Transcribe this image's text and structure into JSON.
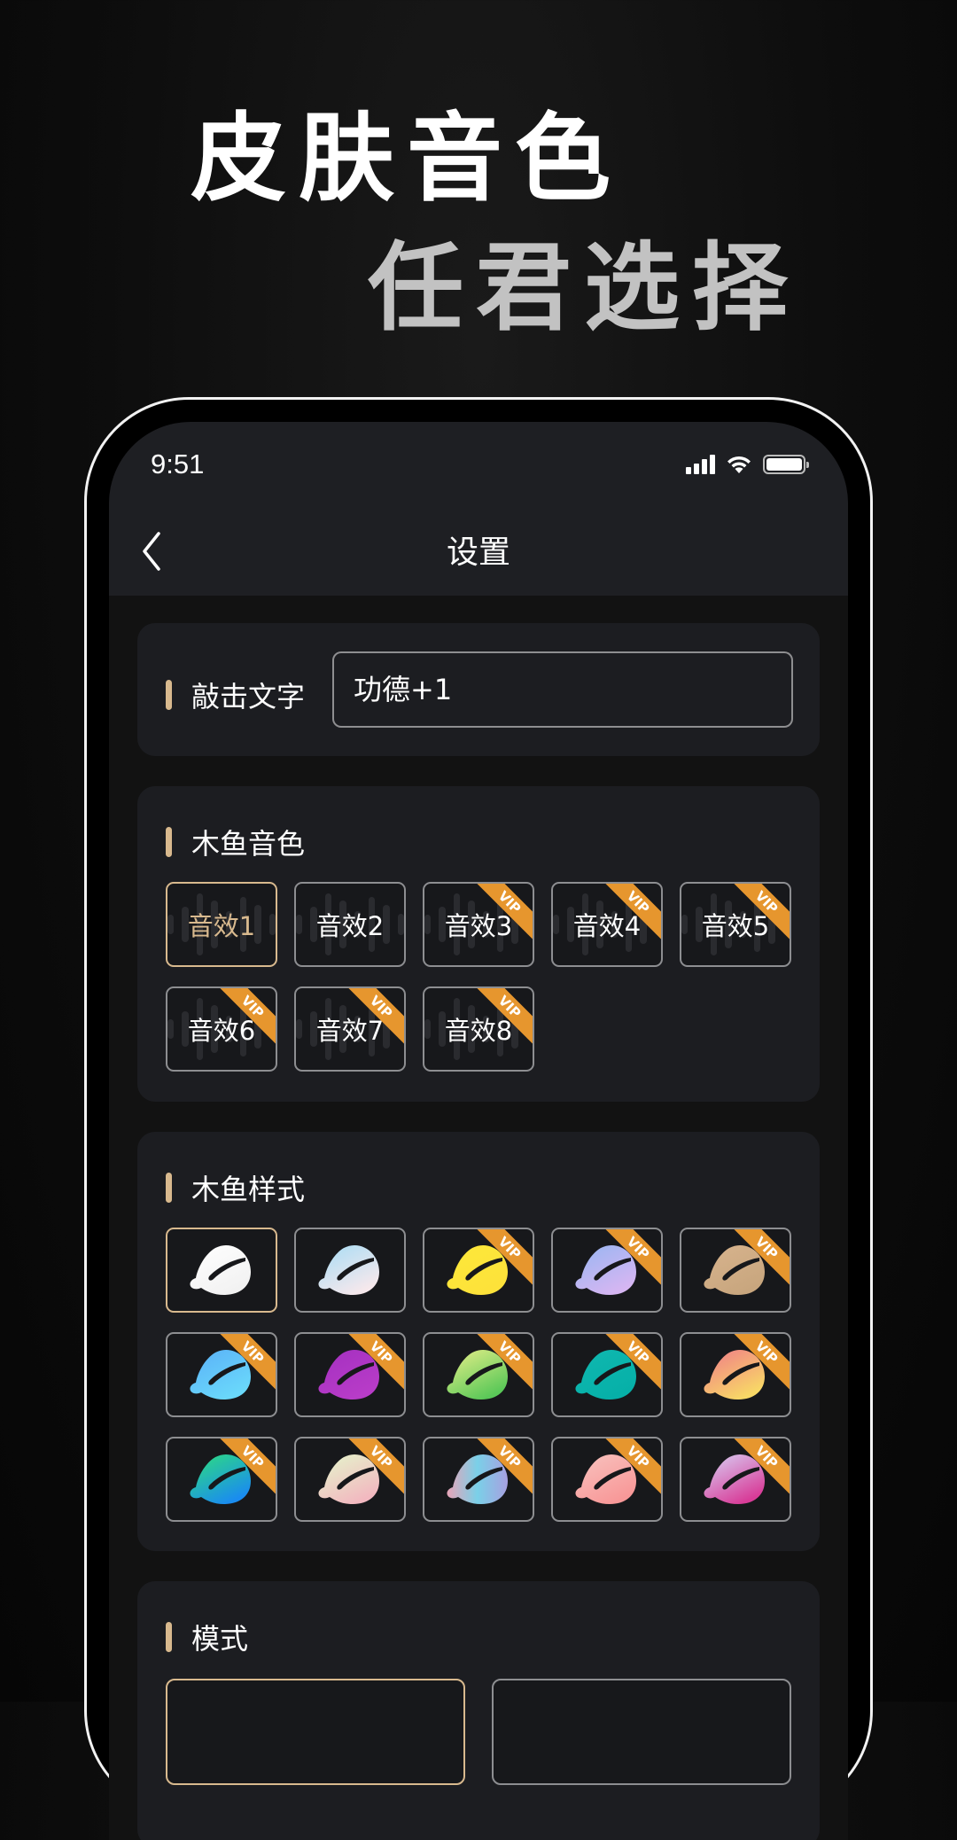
{
  "promo": {
    "line1": "皮肤音色",
    "line2": "任君选择"
  },
  "status_bar": {
    "time": "9:51",
    "icons": [
      "signal-icon",
      "wifi-icon",
      "battery-icon"
    ]
  },
  "nav": {
    "back_icon": "chevron-left-icon",
    "title": "设置"
  },
  "tap_text": {
    "label": "敲击文字",
    "value": "功德+1"
  },
  "sound": {
    "title": "木鱼音色",
    "options": [
      {
        "label": "音效1",
        "vip": false,
        "selected": true
      },
      {
        "label": "音效2",
        "vip": false,
        "selected": false
      },
      {
        "label": "音效3",
        "vip": true,
        "selected": false
      },
      {
        "label": "音效4",
        "vip": true,
        "selected": false
      },
      {
        "label": "音效5",
        "vip": true,
        "selected": false
      },
      {
        "label": "音效6",
        "vip": true,
        "selected": false
      },
      {
        "label": "音效7",
        "vip": true,
        "selected": false
      },
      {
        "label": "音效8",
        "vip": true,
        "selected": false
      }
    ]
  },
  "vip_badge": "VIP",
  "style": {
    "title": "木鱼样式",
    "options": [
      {
        "name": "white",
        "colors": [
          "#ffffff",
          "#f2f2f2"
        ],
        "vip": false,
        "selected": true
      },
      {
        "name": "sky",
        "colors": [
          "#a6dcf5",
          "#f6e8ec"
        ],
        "vip": false,
        "selected": false
      },
      {
        "name": "yellow",
        "colors": [
          "#fde83a",
          "#fde23a"
        ],
        "vip": true,
        "selected": false
      },
      {
        "name": "lavender",
        "colors": [
          "#96b6f2",
          "#d6b6f2"
        ],
        "vip": true,
        "selected": false
      },
      {
        "name": "tan",
        "colors": [
          "#d8b48e",
          "#c8a67e"
        ],
        "vip": true,
        "selected": false
      },
      {
        "name": "blue",
        "colors": [
          "#5ab0f8",
          "#6ad8fa"
        ],
        "vip": true,
        "selected": false
      },
      {
        "name": "purple",
        "colors": [
          "#a430c0",
          "#b83cc8"
        ],
        "vip": true,
        "selected": false
      },
      {
        "name": "lime",
        "colors": [
          "#eaf08a",
          "#5ac858"
        ],
        "vip": true,
        "selected": false
      },
      {
        "name": "teal",
        "colors": [
          "#10b8b0",
          "#06b0a8"
        ],
        "vip": true,
        "selected": false
      },
      {
        "name": "sunset",
        "colors": [
          "#f07a8a",
          "#f8d866"
        ],
        "vip": true,
        "selected": false
      },
      {
        "name": "aqua",
        "colors": [
          "#2ee07a",
          "#1a8cf0"
        ],
        "vip": true,
        "selected": false
      },
      {
        "name": "cream",
        "colors": [
          "#e4f8cc",
          "#f2b8c0"
        ],
        "vip": true,
        "selected": false
      },
      {
        "name": "holo",
        "colors": [
          "#e8a4b8",
          "#7ad0e8",
          "#a8a0e0"
        ],
        "vip": true,
        "selected": false
      },
      {
        "name": "pink",
        "colors": [
          "#f8c4c0",
          "#f89898"
        ],
        "vip": true,
        "selected": false
      },
      {
        "name": "magenta",
        "colors": [
          "#d8d4f8",
          "#d83c98"
        ],
        "vip": true,
        "selected": false
      }
    ]
  },
  "mode": {
    "title": "模式",
    "options": [
      {
        "selected": true
      },
      {
        "selected": false
      }
    ]
  },
  "colors": {
    "accent": "#d8b98e",
    "vip": "#e6962e",
    "card_bg": "#1c1d21",
    "tile_border": "#8d8e91"
  }
}
